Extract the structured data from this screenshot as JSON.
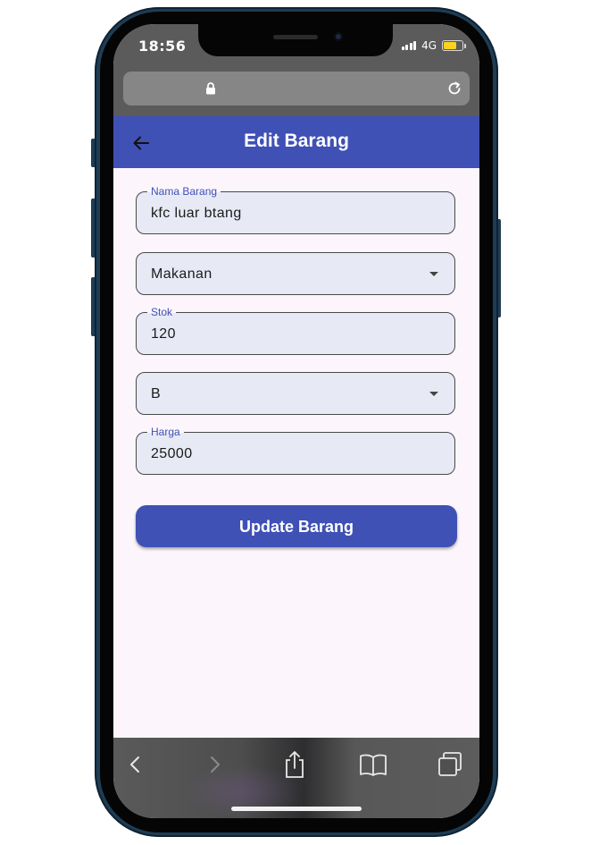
{
  "status_bar": {
    "time": "18:56",
    "network": "4G",
    "battery_level": 0.7,
    "battery_color": "#ffd21e"
  },
  "browser": {
    "url_icon": "lock-icon",
    "reload_icon": "reload-icon",
    "toolbar_icons": [
      "back-chevron-icon",
      "forward-chevron-icon",
      "share-icon",
      "bookmarks-icon",
      "tabs-icon"
    ]
  },
  "app_bar": {
    "title": "Edit Barang",
    "back_icon": "arrow-left-icon",
    "color": "#3f51b5"
  },
  "form": {
    "nama_barang": {
      "label": "Nama Barang",
      "value": "kfc luar btang"
    },
    "kategori": {
      "selected": "Makanan"
    },
    "stok": {
      "label": "Stok",
      "value": "120"
    },
    "grade": {
      "selected": "B"
    },
    "harga": {
      "label": "Harga",
      "value": "25000"
    },
    "submit_label": "Update Barang"
  }
}
